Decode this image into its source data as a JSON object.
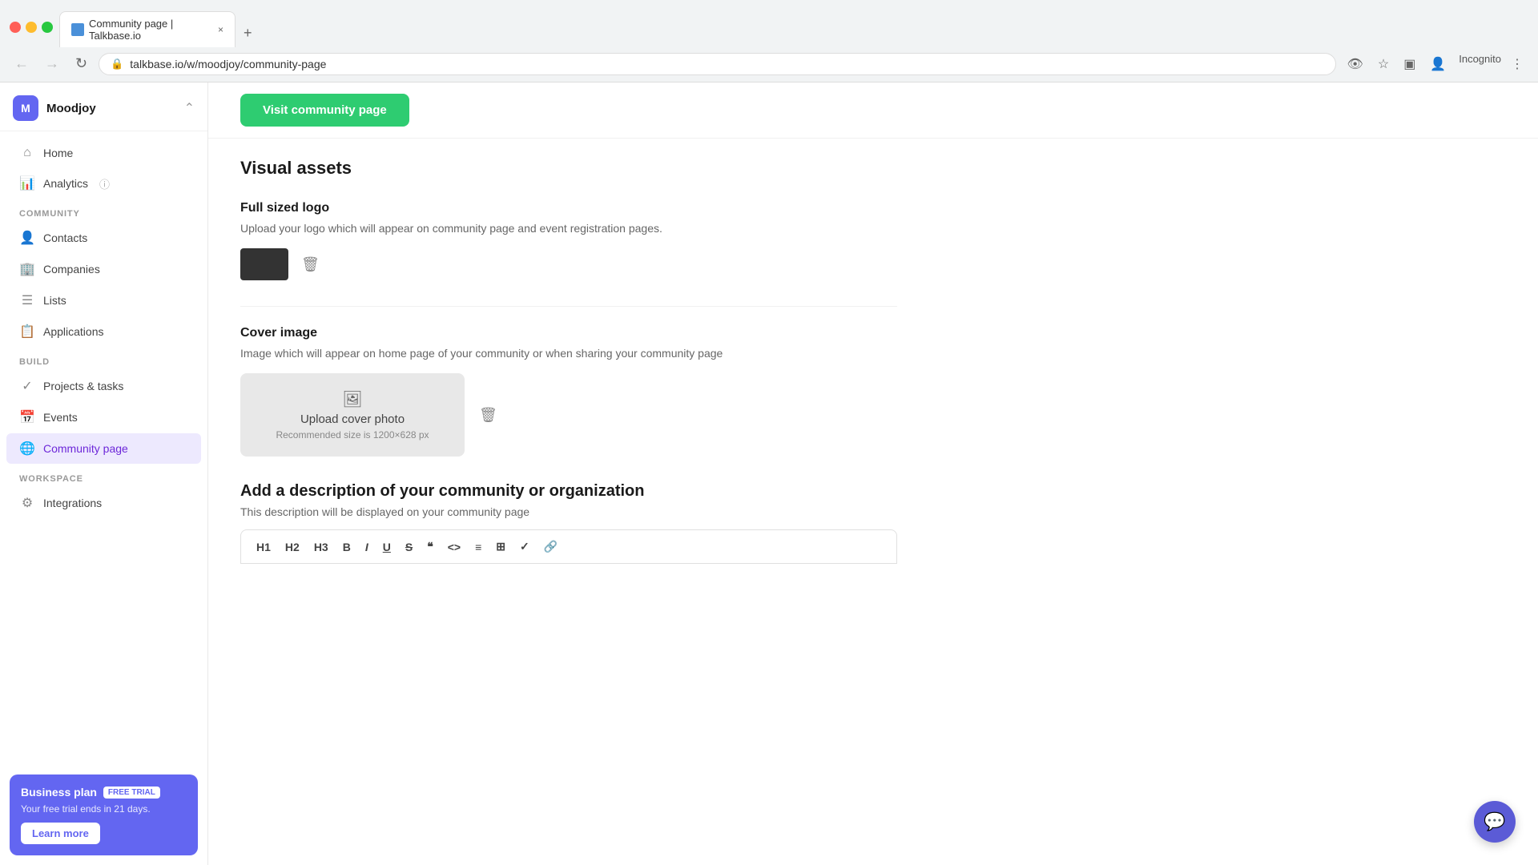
{
  "browser": {
    "tab_title": "Community page | Talkbase.io",
    "tab_close": "×",
    "tab_new": "+",
    "address": "talkbase.io/w/moodjoy/community-page",
    "incognito_label": "Incognito"
  },
  "sidebar": {
    "workspace_name": "Moodjoy",
    "workspace_initial": "M",
    "nav_items": [
      {
        "label": "Home",
        "icon": "⌂",
        "id": "home",
        "active": false
      },
      {
        "label": "Analytics",
        "icon": "📊",
        "id": "analytics",
        "active": false
      }
    ],
    "community_label": "COMMUNITY",
    "community_items": [
      {
        "label": "Contacts",
        "icon": "👤",
        "id": "contacts",
        "active": false
      },
      {
        "label": "Companies",
        "icon": "🏢",
        "id": "companies",
        "active": false
      },
      {
        "label": "Lists",
        "icon": "☰",
        "id": "lists",
        "active": false
      },
      {
        "label": "Applications",
        "icon": "📋",
        "id": "applications",
        "active": false
      }
    ],
    "build_label": "BUILD",
    "build_items": [
      {
        "label": "Projects & tasks",
        "icon": "✓",
        "id": "projects",
        "active": false
      },
      {
        "label": "Events",
        "icon": "📅",
        "id": "events",
        "active": false
      },
      {
        "label": "Community page",
        "icon": "🌐",
        "id": "community-page",
        "active": true
      }
    ],
    "workspace_label": "WORKSPACE",
    "workspace_items": [
      {
        "label": "Integrations",
        "icon": "⚙",
        "id": "integrations",
        "active": false
      }
    ],
    "plan": {
      "title": "Business plan",
      "badge": "FREE TRIAL",
      "desc": "Your free trial ends in 21 days.",
      "cta": "Learn more"
    }
  },
  "main": {
    "visit_btn": "Visit community page",
    "section_title": "Visual assets",
    "logo_section": {
      "label": "Full sized logo",
      "desc": "Upload your logo which will appear on community page and event registration pages."
    },
    "cover_section": {
      "label": "Cover image",
      "desc": "Image which will appear on home page of your community or when sharing your community page",
      "upload_label": "Upload cover photo",
      "upload_hint": "Recommended size is 1200×628 px"
    },
    "description_section": {
      "title": "Add a description of your community or organization",
      "subtitle": "This description will be displayed on your community page"
    },
    "editor_buttons": [
      "H1",
      "H2",
      "H3",
      "B",
      "I",
      "U",
      "S",
      "❝",
      "<>",
      "≡",
      "⊞",
      "✓",
      "🔗"
    ]
  }
}
